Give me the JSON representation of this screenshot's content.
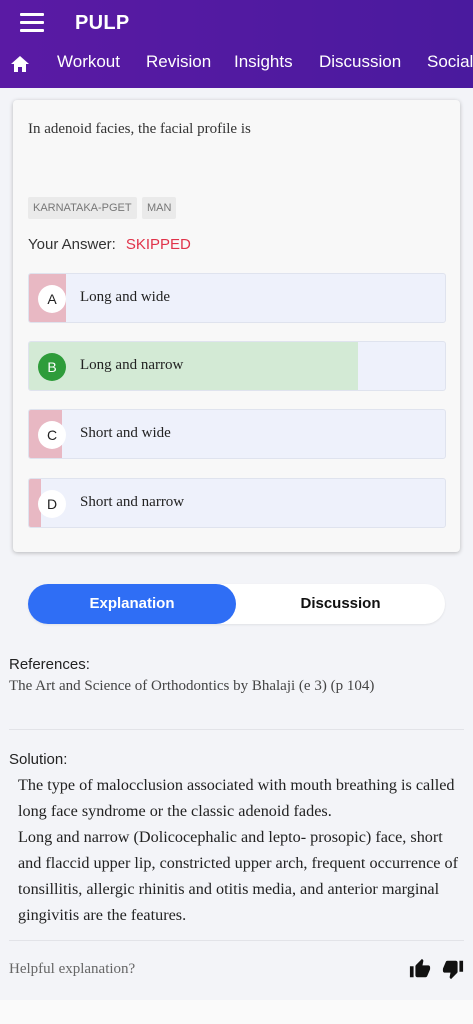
{
  "app": {
    "title": "PULP"
  },
  "nav": {
    "home_icon": "home-icon",
    "tabs": [
      "Workout",
      "Revision",
      "Insights",
      "Discussion",
      "Social"
    ]
  },
  "question": {
    "text": "In adenoid facies, the facial profile is",
    "tags": [
      "KARNATAKA-PGET",
      "MAN"
    ],
    "answer_label": "Your Answer:",
    "answer_value": "SKIPPED",
    "options": [
      {
        "letter": "A",
        "text": "Long and wide",
        "percent": 9,
        "correct": false
      },
      {
        "letter": "B",
        "text": "Long and narrow",
        "percent": 79,
        "correct": true
      },
      {
        "letter": "C",
        "text": "Short and wide",
        "percent": 8,
        "correct": false
      },
      {
        "letter": "D",
        "text": "Short and narrow",
        "percent": 3,
        "correct": false
      }
    ]
  },
  "toggle": {
    "explanation": "Explanation",
    "discussion": "Discussion"
  },
  "references": {
    "title": "References:",
    "text": "The Art and Science of Orthodontics by Bhalaji (e 3) (p 104)"
  },
  "solution": {
    "title": "Solution:",
    "para1": "The type of malocclusion associated with mouth breathing is called long face syndrome or the classic adenoid fades.",
    "para2": "Long and narrow (Dolicocephalic and lepto- prosopic) face, short and flaccid upper lip, constricted upper arch, frequent occurrence of tonsillitis, allergic rhinitis and otitis media, and anterior marginal gingivitis are the features."
  },
  "feedback": {
    "prompt": "Helpful explanation?",
    "like_icon": "thumbs-up-icon",
    "dislike_icon": "thumbs-down-icon"
  },
  "colors": {
    "header": "#5a1aa4",
    "accent": "#2f6ef5",
    "correct": "#2e9c3a",
    "correct_fill": "#d3ead5",
    "wrong_fill": "#e8b8c3",
    "skipped": "#e0334a"
  }
}
